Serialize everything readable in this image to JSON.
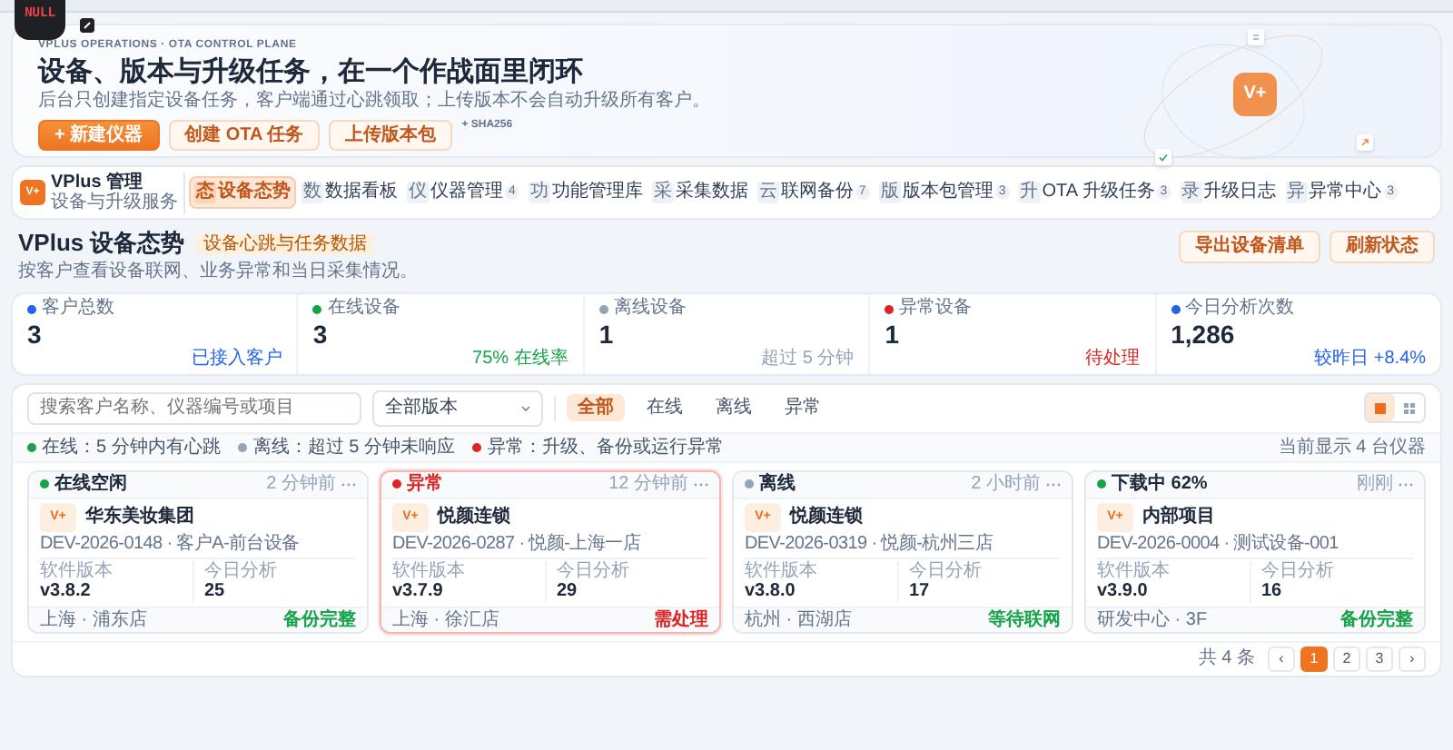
{
  "mascot": {
    "label": "NULL"
  },
  "hero": {
    "kicker": "VPLUS OPERATIONS · OTA CONTROL PLANE",
    "title": "设备、版本与升级任务，在一个作战面里闭环",
    "subtitle": "后台只创建指定设备任务，客户端通过心跳领取；上传版本不会自动升级所有客户。",
    "buttons": [
      {
        "label": "+ 新建仪器",
        "kind": "primary"
      },
      {
        "label": "创建 OTA 任务",
        "kind": "secondary"
      },
      {
        "label": "上传版本包",
        "kind": "secondary"
      }
    ],
    "note": "+ SHA256",
    "logo": "V+"
  },
  "nav": {
    "brand": {
      "logo": "V+",
      "title": "VPlus 管理",
      "subtitle": "设备与升级服务"
    },
    "items": [
      {
        "icon": "态",
        "label": "设备态势",
        "selected": true
      },
      {
        "icon": "数",
        "label": "数据看板",
        "selected": false
      },
      {
        "icon": "仪",
        "label": "仪器管理",
        "count": "4",
        "selected": false
      },
      {
        "icon": "功",
        "label": "功能管理库",
        "selected": false
      },
      {
        "icon": "采",
        "label": "采集数据",
        "selected": false
      },
      {
        "icon": "云",
        "label": "联网备份",
        "count": "7",
        "selected": false
      },
      {
        "icon": "版",
        "label": "版本包管理",
        "count": "3",
        "selected": false
      },
      {
        "icon": "升",
        "label": "OTA 升级任务",
        "count": "3",
        "selected": false
      },
      {
        "icon": "录",
        "label": "升级日志",
        "selected": false
      },
      {
        "icon": "异",
        "label": "异常中心",
        "count": "3",
        "selected": false
      }
    ]
  },
  "page": {
    "title": "VPlus 设备态势",
    "badge": "设备心跳与任务数据",
    "subtitle": "按客户查看设备联网、业务异常和当日采集情况。",
    "buttons": [
      "导出设备清单",
      "刷新状态"
    ]
  },
  "stats": [
    {
      "label": "客户总数",
      "value": "3",
      "note": "已接入客户",
      "color": "#2563eb"
    },
    {
      "label": "在线设备",
      "value": "3",
      "note": "75% 在线率",
      "color": "#16a34a"
    },
    {
      "label": "离线设备",
      "value": "1",
      "note": "超过 5 分钟",
      "color": "#94a3b8"
    },
    {
      "label": "异常设备",
      "value": "1",
      "note": "待处理",
      "color": "#dc2626"
    },
    {
      "label": "今日分析次数",
      "value": "1,286",
      "note": "较昨日 +8.4%",
      "color": "#2563eb"
    }
  ],
  "filters": {
    "search_placeholder": "搜索客户名称、仪器编号或项目",
    "version_select": "全部版本",
    "segments": [
      {
        "label": "全部",
        "selected": true
      },
      {
        "label": "在线",
        "selected": false
      },
      {
        "label": "离线",
        "selected": false
      },
      {
        "label": "异常",
        "selected": false
      }
    ],
    "views": [
      {
        "kind": "grid",
        "selected": true
      },
      {
        "kind": "list",
        "selected": false
      }
    ]
  },
  "legend": [
    {
      "label": "在线：5 分钟内有心跳",
      "color": "#16a34a"
    },
    {
      "label": "离线：超过 5 分钟未响应",
      "color": "#94a3b8"
    },
    {
      "label": "异常：升级、备份或运行异常",
      "color": "#dc2626"
    }
  ],
  "showing": "当前显示 4 台仪器",
  "cards": [
    {
      "status": "在线空闲",
      "color": "#16a34a",
      "time": "2 分钟前",
      "alert": false,
      "logo": "V+",
      "name": "华东美妆集团",
      "id": "DEV-2026-0148 · 客户A-前台设备",
      "metrics": [
        {
          "label": "软件版本",
          "value": "v3.8.2"
        },
        {
          "label": "今日分析",
          "value": "25"
        }
      ],
      "location": "上海 · 浦东店",
      "tag": "备份完整"
    },
    {
      "status": "异常",
      "color": "#dc2626",
      "time": "12 分钟前",
      "alert": true,
      "logo": "V+",
      "name": "悦颜连锁",
      "id": "DEV-2026-0287 · 悦颜-上海一店",
      "metrics": [
        {
          "label": "软件版本",
          "value": "v3.7.9"
        },
        {
          "label": "今日分析",
          "value": "29"
        }
      ],
      "location": "上海 · 徐汇店",
      "tag": "需处理"
    },
    {
      "status": "离线",
      "color": "#94a3b8",
      "time": "2 小时前",
      "alert": false,
      "logo": "V+",
      "name": "悦颜连锁",
      "id": "DEV-2026-0319 · 悦颜-杭州三店",
      "metrics": [
        {
          "label": "软件版本",
          "value": "v3.8.0"
        },
        {
          "label": "今日分析",
          "value": "17"
        }
      ],
      "location": "杭州 · 西湖店",
      "tag": "等待联网"
    },
    {
      "status": "下载中 62%",
      "color": "#16a34a",
      "time": "刚刚",
      "alert": false,
      "logo": "V+",
      "name": "内部项目",
      "id": "DEV-2026-0004 · 测试设备-001",
      "metrics": [
        {
          "label": "软件版本",
          "value": "v3.9.0"
        },
        {
          "label": "今日分析",
          "value": "16"
        }
      ],
      "location": "研发中心 · 3F",
      "tag": "备份完整"
    }
  ],
  "pagination": {
    "total": "共 4 条",
    "prev": "‹",
    "next": "›",
    "pages": [
      {
        "label": "1",
        "selected": true
      },
      {
        "label": "2",
        "selected": false
      },
      {
        "label": "3",
        "selected": false
      }
    ]
  }
}
